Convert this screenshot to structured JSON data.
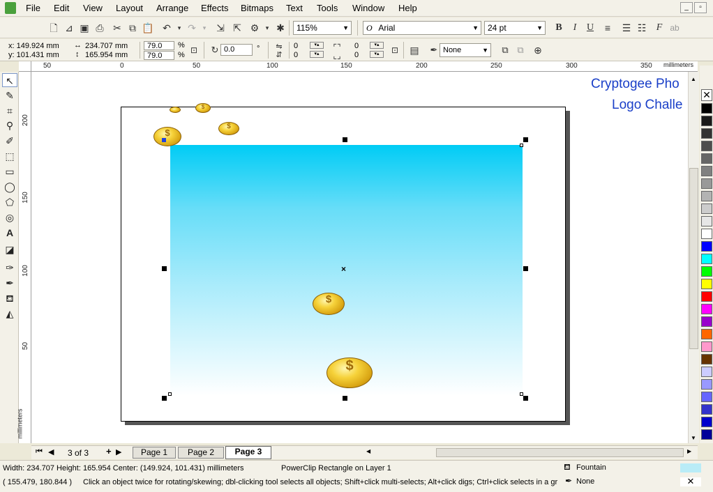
{
  "menu": {
    "items": [
      "File",
      "Edit",
      "View",
      "Layout",
      "Arrange",
      "Effects",
      "Bitmaps",
      "Text",
      "Tools",
      "Window",
      "Help"
    ]
  },
  "toolbar": {
    "zoom": "115%",
    "font_name": "Arial",
    "font_size": "24 pt"
  },
  "property_bar": {
    "x": "x: 149.924 mm",
    "y": "y: 101.431 mm",
    "width": "234.707 mm",
    "height": "165.954 mm",
    "scale_x": "79.0",
    "scale_y": "79.0",
    "percent_x": "%",
    "percent_y": "%",
    "rotation": "0.0",
    "degree": "°",
    "corner_1": "0",
    "corner_2": "0",
    "corner_3": "0",
    "corner_4": "0",
    "outline": "None"
  },
  "rulers": {
    "h_labels": [
      "50",
      "0",
      "50",
      "100",
      "150",
      "200",
      "250",
      "300",
      "350"
    ],
    "h_unit": "millimeters",
    "v_labels": [
      "200",
      "150",
      "100",
      "50"
    ],
    "v_unit": "millimeters"
  },
  "canvas": {
    "title_line1": "Cryptogee Pho",
    "title_line2": "Logo Challe",
    "gradient_top": "#00ccf5",
    "gradient_bottom": "#ffffff",
    "coin_color": "#f2c21b"
  },
  "pages": {
    "counter": "3 of 3",
    "tabs": [
      "Page 1",
      "Page 2",
      "Page 3"
    ],
    "active": "Page 3"
  },
  "status": {
    "dimensions": "Width: 234.707 Height: 165.954 Center: (149.924, 101.431) millimeters",
    "object": "PowerClip Rectangle on Layer 1",
    "coords": "( 155.479, 180.844 )",
    "hint": "Click an object twice for rotating/skewing; dbl-clicking tool selects all objects; Shift+click multi-selects; Alt+click digs; Ctrl+click selects in a gr...",
    "fill_label": "Fountain",
    "outline_label": "None",
    "fill_color": "#b9ecf7"
  },
  "palette": [
    "#ffffff",
    "#000000",
    "#1a1a1a",
    "#333333",
    "#4d4d4d",
    "#666666",
    "#808080",
    "#999999",
    "#b3b3b3",
    "#cccccc",
    "#e6e6e6",
    "#ffffff",
    "#0000ff",
    "#00ffff",
    "#00ff00",
    "#ffff00",
    "#ff0000",
    "#ff00ff",
    "#9900cc",
    "#ff6600",
    "#ff99cc",
    "#663300",
    "#ccccff",
    "#9999ff",
    "#6666ff",
    "#3333cc",
    "#0000cc",
    "#000099"
  ]
}
